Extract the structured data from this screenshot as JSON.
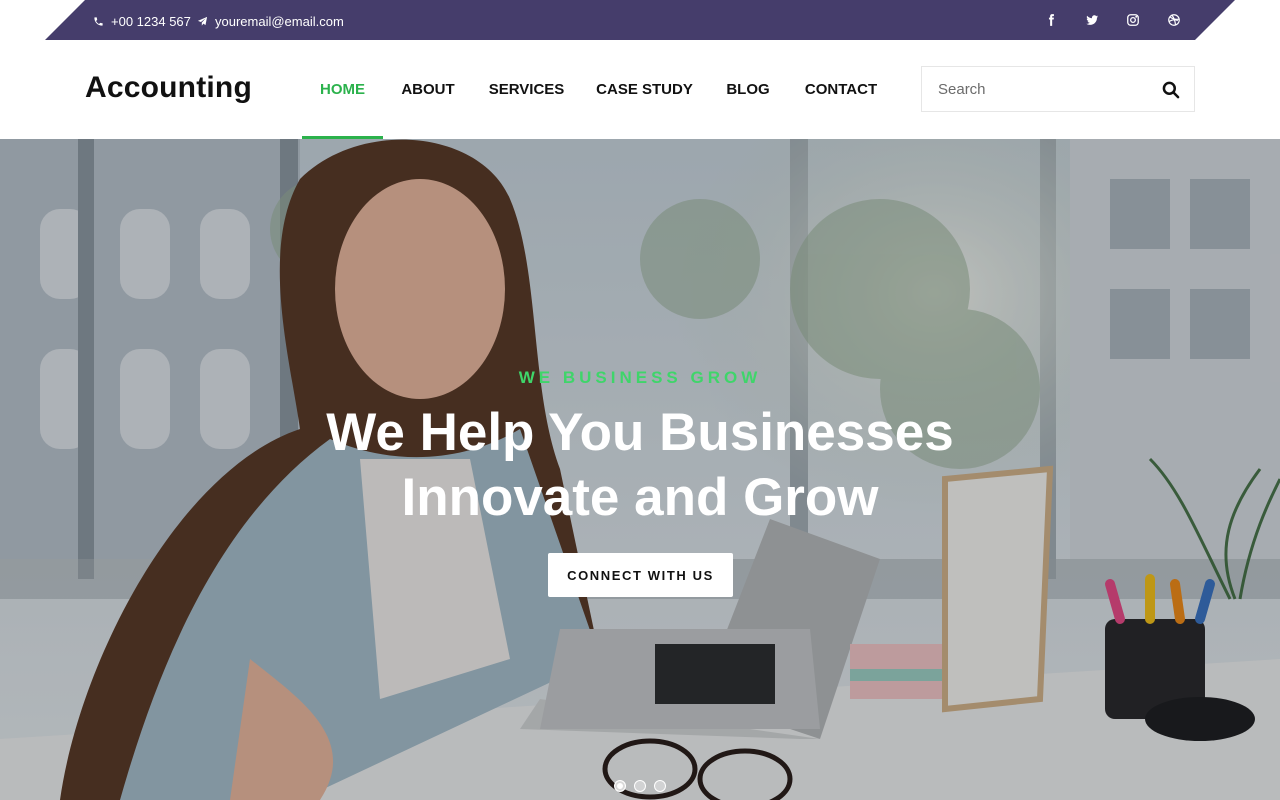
{
  "topbar": {
    "phone": "+00 1234 567",
    "email": "youremail@email.com",
    "social": [
      "facebook-icon",
      "twitter-icon",
      "instagram-icon",
      "dribbble-icon"
    ]
  },
  "header": {
    "logo": "Accounting",
    "nav": [
      "HOME",
      "ABOUT",
      "SERVICES",
      "CASE STUDY",
      "BLOG",
      "CONTACT"
    ],
    "active_nav": "HOME",
    "search_placeholder": "Search"
  },
  "hero": {
    "eyebrow": "WE BUSINESS GROW",
    "headline_line1": "We Help You Businesses",
    "headline_line2": "Innovate and Grow",
    "cta": "CONNECT WITH US",
    "slides_total": 3,
    "active_slide": 1
  },
  "colors": {
    "topbar": "#453d6b",
    "accent": "#2bb24c",
    "eyebrow": "#3fd56a"
  }
}
